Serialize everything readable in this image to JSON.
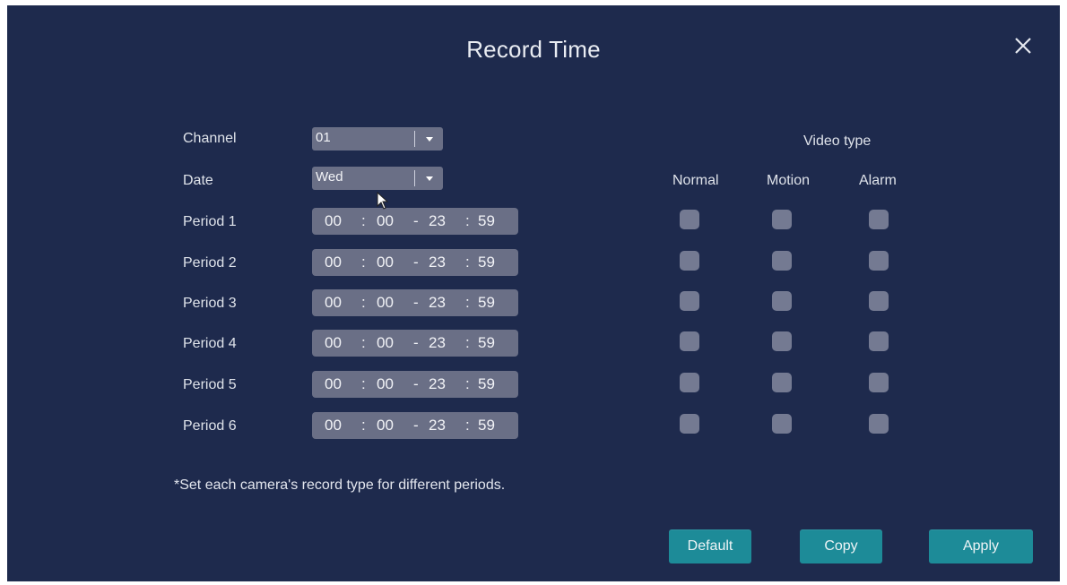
{
  "dialog": {
    "title": "Record Time",
    "close_icon": "close-icon"
  },
  "form": {
    "channel_label": "Channel",
    "channel_value": "01",
    "date_label": "Date",
    "date_value": "Wed"
  },
  "periods": [
    {
      "label": "Period 1",
      "start_h": "00",
      "start_m": "00",
      "end_h": "23",
      "end_m": "59"
    },
    {
      "label": "Period 2",
      "start_h": "00",
      "start_m": "00",
      "end_h": "23",
      "end_m": "59"
    },
    {
      "label": "Period 3",
      "start_h": "00",
      "start_m": "00",
      "end_h": "23",
      "end_m": "59"
    },
    {
      "label": "Period 4",
      "start_h": "00",
      "start_m": "00",
      "end_h": "23",
      "end_m": "59"
    },
    {
      "label": "Period 5",
      "start_h": "00",
      "start_m": "00",
      "end_h": "23",
      "end_m": "59"
    },
    {
      "label": "Period 6",
      "start_h": "00",
      "start_m": "00",
      "end_h": "23",
      "end_m": "59"
    }
  ],
  "separators": {
    "colon": ":",
    "dash": "-"
  },
  "video_type": {
    "heading": "Video type",
    "columns": [
      "Normal",
      "Motion",
      "Alarm"
    ]
  },
  "note": "*Set each camera's record type for different periods.",
  "buttons": {
    "default": "Default",
    "copy": "Copy",
    "apply": "Apply"
  },
  "colors": {
    "background": "#1e2a4d",
    "field": "#6a6f86",
    "checkbox": "#747a92",
    "button": "#1d8b98"
  }
}
